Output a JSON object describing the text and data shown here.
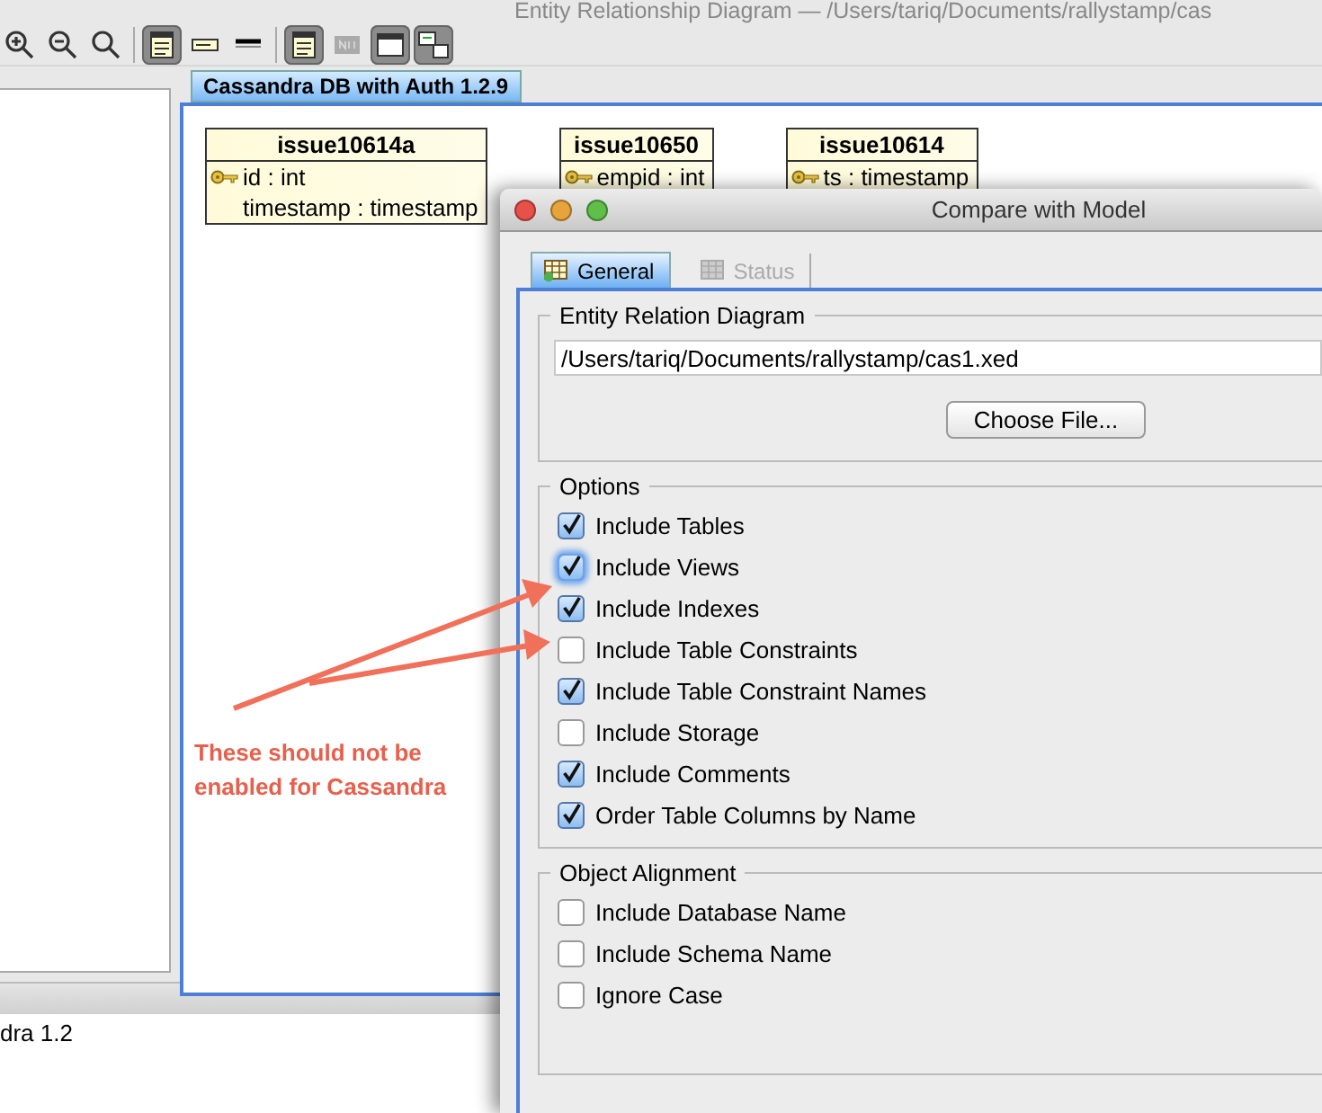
{
  "app": {
    "title": "Entity Relationship Diagram — /Users/tariq/Documents/rallystamp/cas",
    "diagram_tab": "Cassandra DB with Auth 1.2.9",
    "tables": [
      {
        "name": "issue10614a",
        "columns": [
          {
            "text": "id : int",
            "key": true
          },
          {
            "text": "timestamp : timestamp",
            "key": false
          }
        ]
      },
      {
        "name": "issue10650",
        "columns": [
          {
            "text": "empid : int",
            "key": true
          }
        ]
      },
      {
        "name": "issue10614",
        "columns": [
          {
            "text": "ts : timestamp",
            "key": true
          }
        ]
      }
    ],
    "status_text": "dra 1.2"
  },
  "dialog": {
    "title": "Compare with Model",
    "tabs": [
      {
        "label": "General",
        "selected": true,
        "disabled": false
      },
      {
        "label": "Status",
        "selected": false,
        "disabled": true
      }
    ],
    "erd_group": {
      "title": "Entity Relation Diagram",
      "path": "/Users/tariq/Documents/rallystamp/cas1.xed",
      "button": "Choose File..."
    },
    "options": {
      "title": "Options",
      "items": [
        {
          "label": "Include Tables",
          "checked": true,
          "focused": false
        },
        {
          "label": "Include Views",
          "checked": true,
          "focused": true
        },
        {
          "label": "Include Indexes",
          "checked": true,
          "focused": false
        },
        {
          "label": "Include Table Constraints",
          "checked": false,
          "focused": false
        },
        {
          "label": "Include Table Constraint Names",
          "checked": true,
          "focused": false
        },
        {
          "label": "Include Storage",
          "checked": false,
          "focused": false
        },
        {
          "label": "Include Comments",
          "checked": true,
          "focused": false
        },
        {
          "label": "Order Table Columns by Name",
          "checked": true,
          "focused": false
        }
      ]
    },
    "alignment": {
      "title": "Object Alignment",
      "items": [
        {
          "label": "Include Database Name",
          "checked": false,
          "focused": false
        },
        {
          "label": "Include Schema Name",
          "checked": false,
          "focused": false
        },
        {
          "label": "Ignore Case",
          "checked": false,
          "focused": false
        }
      ]
    }
  },
  "annotation": {
    "text": "These should not be enabled for Cassandra"
  }
}
